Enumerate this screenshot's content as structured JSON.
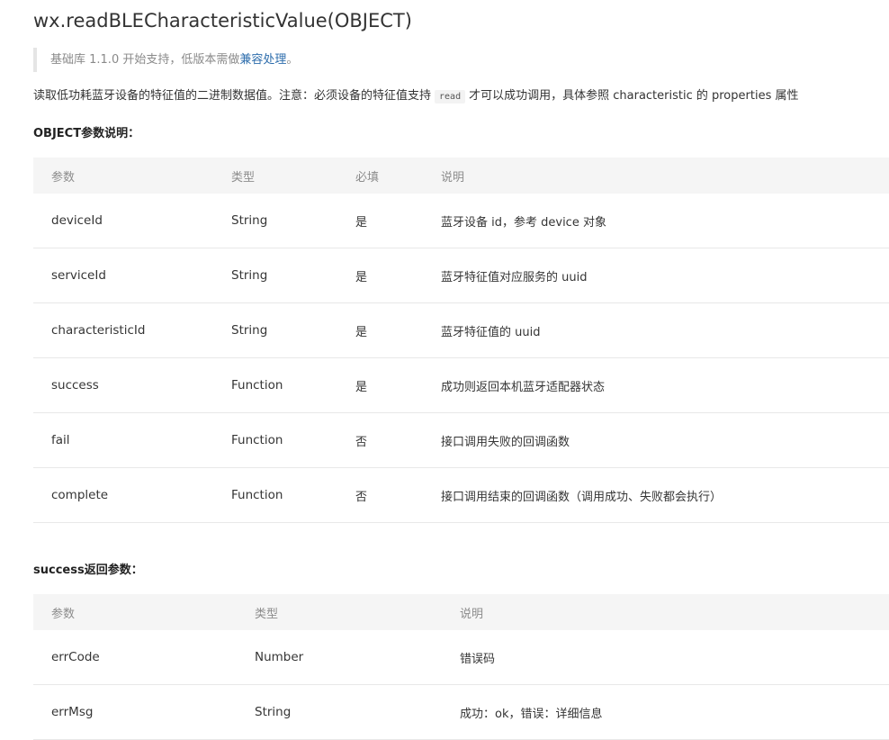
{
  "title": "wx.readBLECharacteristicValue(OBJECT)",
  "tip": {
    "prefix": "基础库 1.1.0 开始支持，低版本需做",
    "link": "兼容处理",
    "suffix": "。"
  },
  "description": {
    "before": "读取低功耗蓝牙设备的特征值的二进制数据值。注意：必须设备的特征值支持",
    "code": "read",
    "after": "才可以成功调用，具体参照 characteristic 的 properties 属性"
  },
  "object_params": {
    "heading": "OBJECT参数说明：",
    "columns": [
      "参数",
      "类型",
      "必填",
      "说明"
    ],
    "rows": [
      [
        "deviceId",
        "String",
        "是",
        "蓝牙设备 id，参考 device 对象"
      ],
      [
        "serviceId",
        "String",
        "是",
        "蓝牙特征值对应服务的 uuid"
      ],
      [
        "characteristicId",
        "String",
        "是",
        "蓝牙特征值的 uuid"
      ],
      [
        "success",
        "Function",
        "是",
        "成功则返回本机蓝牙适配器状态"
      ],
      [
        "fail",
        "Function",
        "否",
        "接口调用失败的回调函数"
      ],
      [
        "complete",
        "Function",
        "否",
        "接口调用结束的回调函数（调用成功、失败都会执行）"
      ]
    ]
  },
  "success_params": {
    "heading": "success返回参数：",
    "columns": [
      "参数",
      "类型",
      "说明"
    ],
    "rows": [
      [
        "errCode",
        "Number",
        "错误码"
      ],
      [
        "errMsg",
        "String",
        "成功：ok，错误：详细信息"
      ]
    ]
  }
}
